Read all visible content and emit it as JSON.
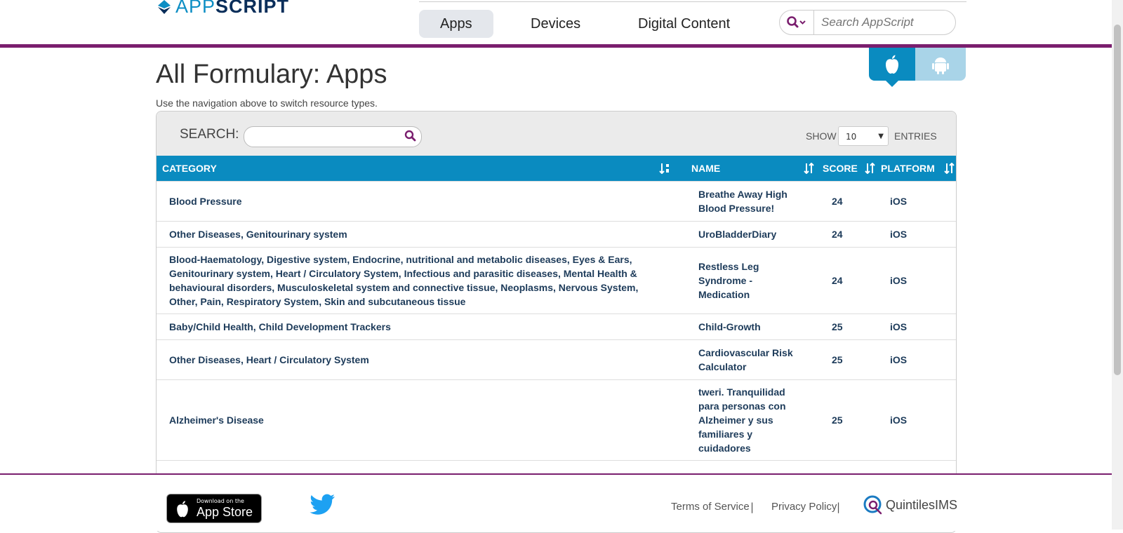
{
  "header": {
    "logo": {
      "app": "APP",
      "script": "SCRIPT"
    },
    "nav": [
      {
        "label": "Apps",
        "active": true
      },
      {
        "label": "Devices",
        "active": false
      },
      {
        "label": "Digital Content",
        "active": false
      }
    ],
    "search_placeholder": "Search AppScript",
    "accent_color": "#7a1e6e"
  },
  "platform_toggle": {
    "active": "ios-icon",
    "inactive": "android-icon"
  },
  "page": {
    "title": "All Formulary: Apps",
    "subtitle": "Use the navigation above to switch resource types."
  },
  "table_controls": {
    "search_label": "SEARCH:",
    "search_value": "",
    "show_label": "SHOW",
    "show_value": "10",
    "entries_label": "ENTRIES"
  },
  "table": {
    "header_color": "#0a8bc0",
    "columns": [
      "CATEGORY",
      "NAME",
      "SCORE",
      "PLATFORM"
    ],
    "rows": [
      {
        "category": "Blood Pressure",
        "name": "Breathe Away High Blood Pressure!",
        "score": "24",
        "platform": "iOS"
      },
      {
        "category": "Other Diseases, Genitourinary system",
        "name": "UroBladderDiary",
        "score": "24",
        "platform": "iOS"
      },
      {
        "category": "Blood-Haematology, Digestive system, Endocrine, nutritional and metabolic diseases, Eyes & Ears, Genitourinary system, Heart / Circulatory System, Infectious and parasitic diseases, Mental Health & behavioural disorders, Musculoskeletal system and connective tissue, Neoplasms, Nervous System, Other, Pain, Respiratory System, Skin and subcutaneous tissue",
        "name": "Restless Leg Syndrome - Medication",
        "score": "24",
        "platform": "iOS"
      },
      {
        "category": "Baby/Child Health, Child Development Trackers",
        "name": "Child-Growth",
        "score": "25",
        "platform": "iOS"
      },
      {
        "category": "Other Diseases, Heart / Circulatory System",
        "name": "Cardiovascular Risk Calculator",
        "score": "25",
        "platform": "iOS"
      },
      {
        "category": "Alzheimer's Disease",
        "name": "tweri. Tranquilidad para personas con Alzheimer y sus familiares y cuidadores",
        "score": "25",
        "platform": "iOS"
      }
    ]
  },
  "footer": {
    "appstore_small": "Download on the",
    "appstore_big": "App Store",
    "terms": "Terms of Service",
    "privacy": "Privacy Policy",
    "separator": "|",
    "quintiles": "QuintilesIMS"
  }
}
